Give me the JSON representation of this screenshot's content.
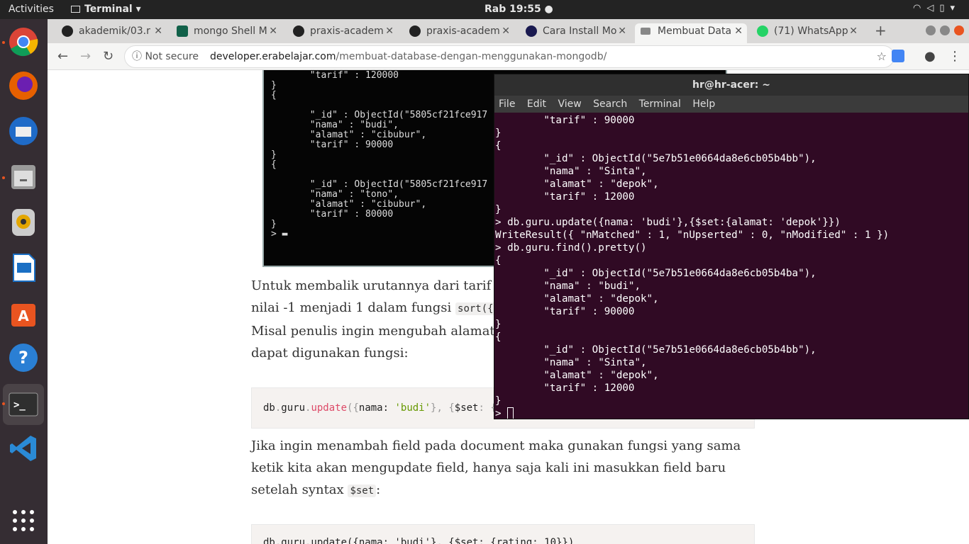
{
  "topbar": {
    "activities": "Activities",
    "app": "Terminal ▾",
    "clock": "Rab 19:55 ●",
    "tray": "▾"
  },
  "dock": {
    "items": [
      "chrome",
      "firefox",
      "thunderbird",
      "files",
      "rhythmbox",
      "writer",
      "software",
      "help",
      "terminal",
      "vscode",
      "apps"
    ]
  },
  "tabs": [
    {
      "label": "akademik/03.r",
      "icon": "github-icon"
    },
    {
      "label": "mongo Shell M",
      "icon": "mongodb-icon"
    },
    {
      "label": "praxis-academ",
      "icon": "github-icon"
    },
    {
      "label": "praxis-academ",
      "icon": "github-icon"
    },
    {
      "label": "Cara Install Mo",
      "icon": "n-icon"
    },
    {
      "label": "Membuat Data",
      "icon": "page-icon",
      "active": true
    },
    {
      "label": "(71) WhatsApp",
      "icon": "whatsapp-icon"
    }
  ],
  "omnibox": {
    "security": "Not secure",
    "domain": "developer.erabelajar.com",
    "path": "/membuat-database-dengan-menggunakan-mongodb/"
  },
  "shot": {
    "text": "       \"tarif\" : 120000\n}\n{\n\n       \"_id\" : ObjectId(\"5805cf21fce917\n       \"nama\" : \"budi\",\n       \"alamat\" : \"cibubur\",\n       \"tarif\" : 90000\n}\n{\n\n       \"_id\" : ObjectId(\"5805cf21fce917\n       \"nama\" : \"tono\",\n       \"alamat\" : \"cibubur\",\n       \"tarif\" : 80000\n}\n> ▬"
  },
  "article": {
    "p1": "Untuk membalik urutannya dari tarif t",
    "p1b": "nilai -1 menjadi 1 dalam fungsi",
    "p1code": "sort({t",
    "p2": "Misal penulis ingin mengubah alamat b",
    "p2b": "dapat digunakan fungsi:",
    "code1": {
      "a": "db",
      "b": ".",
      "c": "guru",
      "d": ".",
      "e": "update",
      "f": "({",
      "g": "nama: ",
      "h": "'budi'",
      "i": "}, {",
      "j": "$set",
      "k": ": {a"
    },
    "p3": "Jika ingin menambah field pada document maka gunakan fungsi yang sama",
    "p3b": "ketik kita akan mengupdate field, hanya saja kali ini masukkan field baru",
    "p3c": "setelah syntax",
    "p3code": "$set",
    "p3end": ":",
    "code2": "db.guru.update({nama: 'budi'}, {$set: {rating: 10}})"
  },
  "terminal": {
    "title": "hr@hr-acer: ~",
    "menu": [
      "File",
      "Edit",
      "View",
      "Search",
      "Terminal",
      "Help"
    ],
    "output": "        \"tarif\" : 90000\n}\n{\n        \"_id\" : ObjectId(\"5e7b51e0664da8e6cb05b4bb\"),\n        \"nama\" : \"Sinta\",\n        \"alamat\" : \"depok\",\n        \"tarif\" : 12000\n}\n> db.guru.update({nama: 'budi'},{$set:{alamat: 'depok'}})\nWriteResult({ \"nMatched\" : 1, \"nUpserted\" : 0, \"nModified\" : 1 })\n> db.guru.find().pretty()\n{\n        \"_id\" : ObjectId(\"5e7b51e0664da8e6cb05b4ba\"),\n        \"nama\" : \"budi\",\n        \"alamat\" : \"depok\",\n        \"tarif\" : 90000\n}\n{\n        \"_id\" : ObjectId(\"5e7b51e0664da8e6cb05b4bb\"),\n        \"nama\" : \"Sinta\",\n        \"alamat\" : \"depok\",\n        \"tarif\" : 12000\n}\n> "
  }
}
